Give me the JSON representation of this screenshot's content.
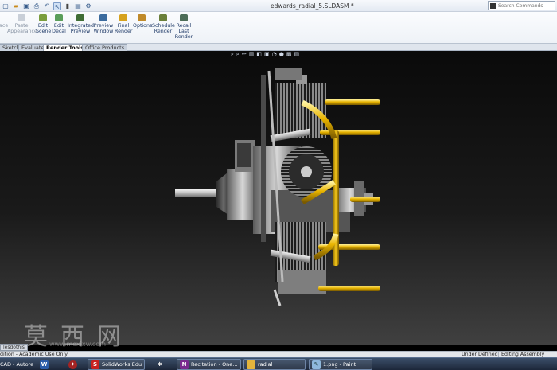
{
  "window": {
    "title": "edwards_radial_5.SLDASM *",
    "search_placeholder": "Search Commands"
  },
  "ribbon": {
    "buttons": [
      {
        "label": "ace",
        "icon": "appearance-icon",
        "enabled": false
      },
      {
        "label": "Paste Appearance",
        "icon": "paste-appearance-icon",
        "enabled": false
      },
      {
        "label": "Edit Scene",
        "icon": "edit-scene-icon",
        "enabled": true
      },
      {
        "label": "Edit Decal",
        "icon": "edit-decal-icon",
        "enabled": true
      },
      {
        "label": "Integrated Preview",
        "icon": "integrated-preview-icon",
        "enabled": true
      },
      {
        "label": "Preview Window",
        "icon": "preview-window-icon",
        "enabled": true
      },
      {
        "label": "Final Render",
        "icon": "final-render-icon",
        "enabled": true
      },
      {
        "label": "Options",
        "icon": "options-icon",
        "enabled": true
      },
      {
        "label": "Schedule Render",
        "icon": "schedule-render-icon",
        "enabled": true
      },
      {
        "label": "Recall Last Render",
        "icon": "recall-last-render-icon",
        "enabled": true
      }
    ]
  },
  "tabs": [
    {
      "label": "Sketch",
      "active": false
    },
    {
      "label": "Evaluate",
      "active": false
    },
    {
      "label": "Render Tools",
      "active": true
    },
    {
      "label": "Office Products",
      "active": false
    }
  ],
  "feature_tab": "lesdothis",
  "status_bar": {
    "left": "dition - Academic Use Only",
    "middle": "Under Defined",
    "right": "Editing Assembly"
  },
  "taskbar": {
    "items": [
      {
        "label": "CAD - Autore",
        "icon": "autocad-icon"
      },
      {
        "label": "",
        "icon": "word-icon"
      },
      {
        "label": "",
        "icon": "app-icon"
      },
      {
        "label": "SolidWorks Edu",
        "icon": "solidworks-icon"
      },
      {
        "label": "",
        "icon": "solidworks-logo-icon"
      },
      {
        "label": "Recitation - One...",
        "icon": "onenote-icon"
      },
      {
        "label": "radial",
        "icon": "folder-icon"
      },
      {
        "label": "1.png - Paint",
        "icon": "paint-icon"
      }
    ]
  },
  "watermark": {
    "text": "莫西网",
    "sub": "www.moxixw.com"
  },
  "colors": {
    "ribbon_text": "#1f3a68",
    "brass": "#e8b400",
    "background": "#000000"
  }
}
